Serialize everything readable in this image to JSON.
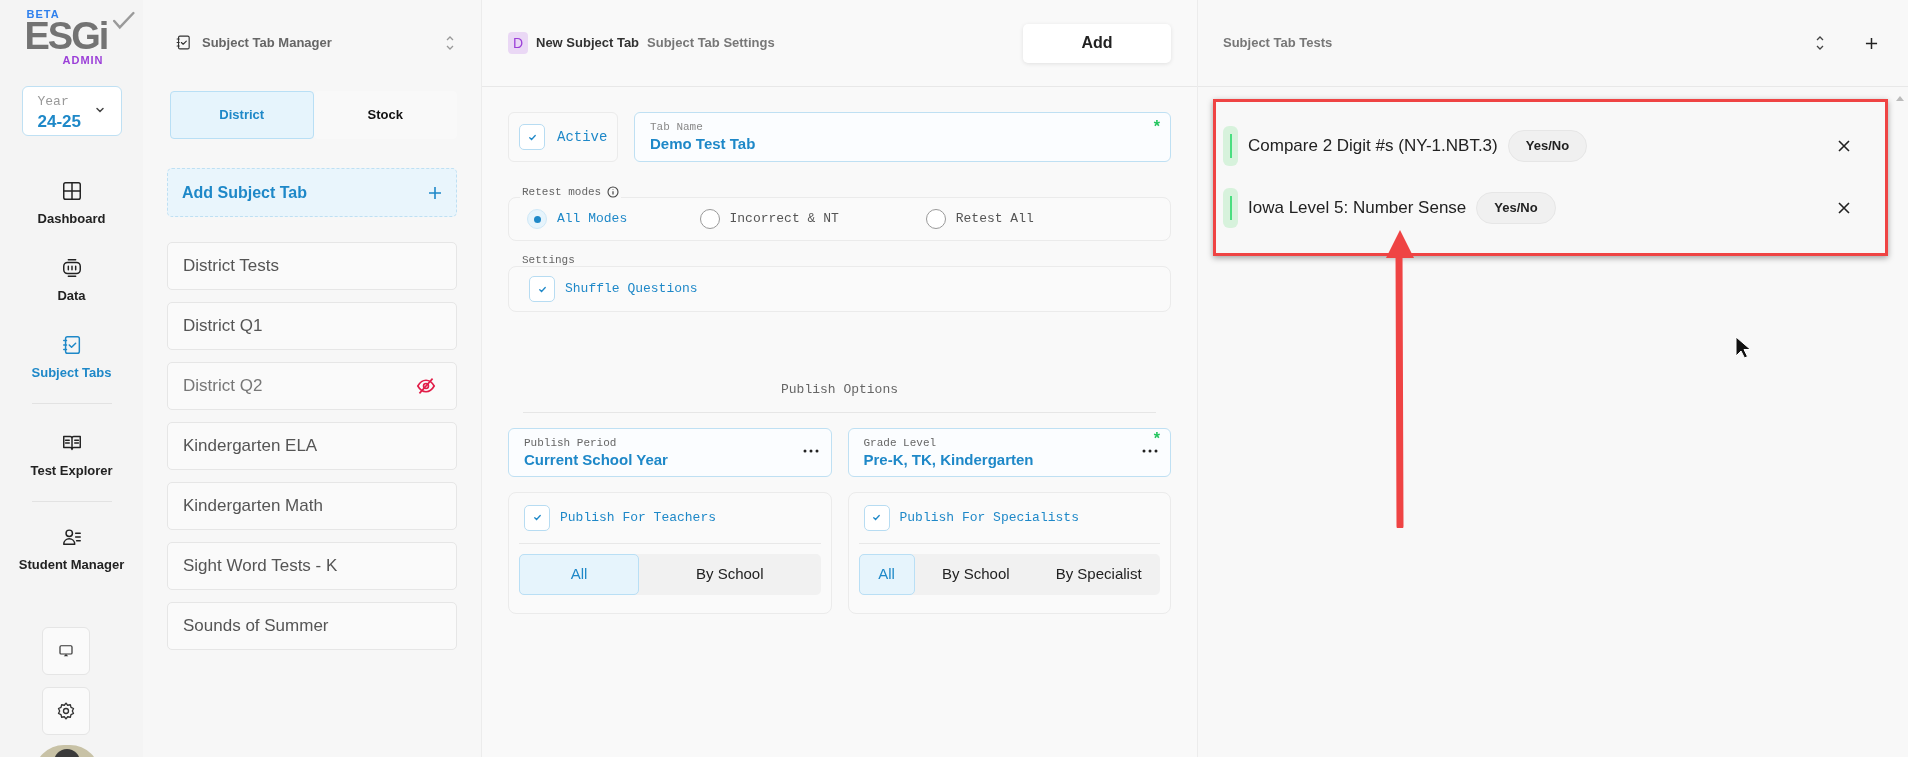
{
  "logo": {
    "beta": "BETA",
    "name": "ESGi",
    "sub": "ADMIN"
  },
  "year": {
    "label": "Year",
    "value": "24-25"
  },
  "nav": [
    {
      "label": "Dashboard",
      "kind": "grid",
      "selected": false
    },
    {
      "label": "Data",
      "kind": "data",
      "selected": false
    },
    {
      "label": "Subject Tabs",
      "kind": "tabs",
      "selected": true
    },
    {
      "label": "Test Explorer",
      "kind": "book",
      "selected": false
    },
    {
      "label": "Student Manager",
      "kind": "users",
      "selected": false
    }
  ],
  "sidebar": {
    "title": "Subject Tab Manager",
    "tabs": [
      {
        "label": "District",
        "selected": true
      },
      {
        "label": "Stock",
        "selected": false
      }
    ],
    "add_label": "Add Subject Tab",
    "items": [
      {
        "label": "District Tests",
        "hidden": false
      },
      {
        "label": "District Q1",
        "hidden": false
      },
      {
        "label": "District Q2",
        "hidden": true
      },
      {
        "label": "Kindergarten ELA",
        "hidden": false
      },
      {
        "label": "Kindergarten Math",
        "hidden": false
      },
      {
        "label": "Sight Word Tests - K",
        "hidden": false
      },
      {
        "label": "Sounds of Summer",
        "hidden": false
      }
    ]
  },
  "editor": {
    "badge": "D",
    "title": "New Subject Tab",
    "subtitle": "Subject Tab Settings",
    "add_button": "Add",
    "active": {
      "label": "Active",
      "checked": true
    },
    "tab_name": {
      "label": "Tab Name",
      "value": "Demo Test Tab",
      "required_mark": "*"
    },
    "retest": {
      "legend": "Retest modes",
      "options": [
        {
          "label": "All Modes",
          "selected": true
        },
        {
          "label": "Incorrect & NT",
          "selected": false
        },
        {
          "label": "Retest All",
          "selected": false
        }
      ]
    },
    "settings": {
      "legend": "Settings",
      "options": [
        {
          "label": "Shuffle Questions",
          "checked": true
        }
      ]
    },
    "publish_heading": "Publish Options",
    "fields": [
      {
        "label": "Publish Period",
        "value": "Current School Year"
      },
      {
        "label": "Grade Level",
        "value": "Pre-K, TK, Kindergarten",
        "required_mark": "*"
      }
    ],
    "publish_cards": [
      {
        "label": "Publish For Teachers",
        "checked": true,
        "segments": [
          {
            "label": "All",
            "selected": true
          },
          {
            "label": "By School",
            "selected": false
          }
        ]
      },
      {
        "label": "Publish For Specialists",
        "checked": true,
        "segments": [
          {
            "label": "All",
            "selected": true
          },
          {
            "label": "By School",
            "selected": false
          },
          {
            "label": "By Specialist",
            "selected": false
          }
        ]
      }
    ]
  },
  "tests_panel": {
    "title": "Subject Tab Tests",
    "tests": [
      {
        "name": "Compare 2 Digit #s (NY-1.NBT.3)",
        "badge": "Yes/No"
      },
      {
        "name": "Iowa Level 5: Number Sense",
        "badge": "Yes/No"
      }
    ]
  }
}
